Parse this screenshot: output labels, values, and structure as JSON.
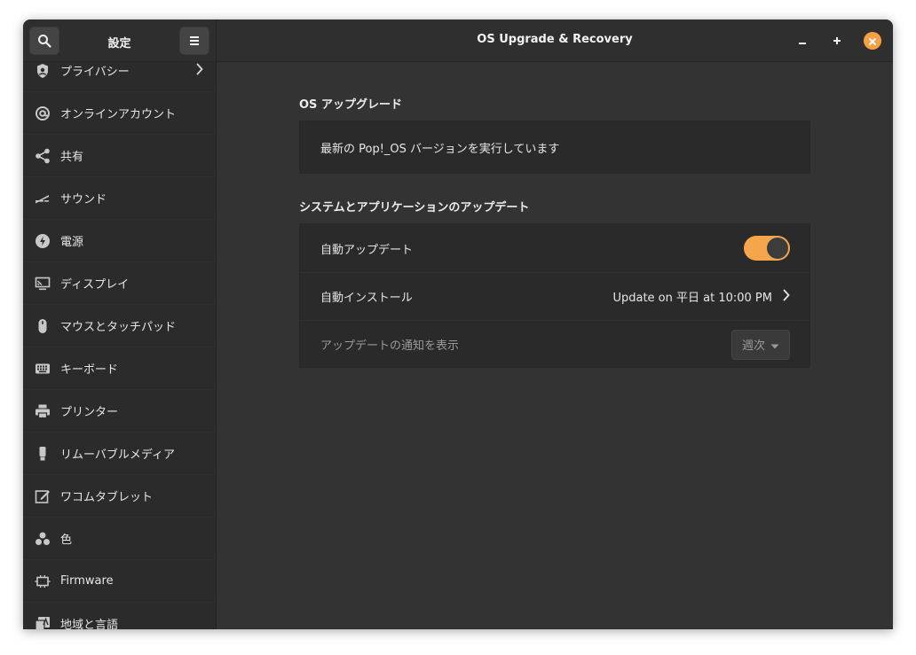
{
  "header": {
    "sidebar_title": "設定",
    "window_title": "OS Upgrade & Recovery",
    "icons": {
      "search": "search-icon",
      "menu": "hamburger-menu-icon",
      "minimize": "minimize-icon",
      "maximize": "maximize-icon",
      "close": "close-icon"
    }
  },
  "sidebar": {
    "items": [
      {
        "label": "プライバシー",
        "icon": "privacy-icon",
        "has_chevron": true
      },
      {
        "label": "オンラインアカウント",
        "icon": "at-icon"
      },
      {
        "label": "共有",
        "icon": "share-icon"
      },
      {
        "label": "サウンド",
        "icon": "sound-icon"
      },
      {
        "label": "電源",
        "icon": "power-icon"
      },
      {
        "label": "ディスプレイ",
        "icon": "display-icon"
      },
      {
        "label": "マウスとタッチパッド",
        "icon": "mouse-icon"
      },
      {
        "label": "キーボード",
        "icon": "keyboard-icon"
      },
      {
        "label": "プリンター",
        "icon": "printer-icon"
      },
      {
        "label": "リムーバブルメディア",
        "icon": "removable-media-icon"
      },
      {
        "label": "ワコムタブレット",
        "icon": "tablet-icon"
      },
      {
        "label": "色",
        "icon": "color-icon"
      },
      {
        "label": "Firmware",
        "icon": "firmware-chip-icon"
      },
      {
        "label": "地域と言語",
        "icon": "language-icon"
      }
    ]
  },
  "main": {
    "os_upgrade": {
      "title": "OS アップグレード",
      "status": "最新の Pop!_OS バージョンを実行しています"
    },
    "updates": {
      "title": "システムとアプリケーションのアップデート",
      "auto_update": {
        "label": "自動アップデート",
        "enabled": true
      },
      "auto_install": {
        "label": "自動インストール",
        "value": "Update on 平日 at 10:00 PM"
      },
      "notify": {
        "label": "アップデートの通知を表示",
        "selected": "週次"
      }
    }
  },
  "colors": {
    "accent": "#f5a64d",
    "close_button": "#f5a043",
    "window_bg": "#333333",
    "sidebar_bg": "#2b2b2b",
    "card_bg": "#2a2a2a"
  }
}
